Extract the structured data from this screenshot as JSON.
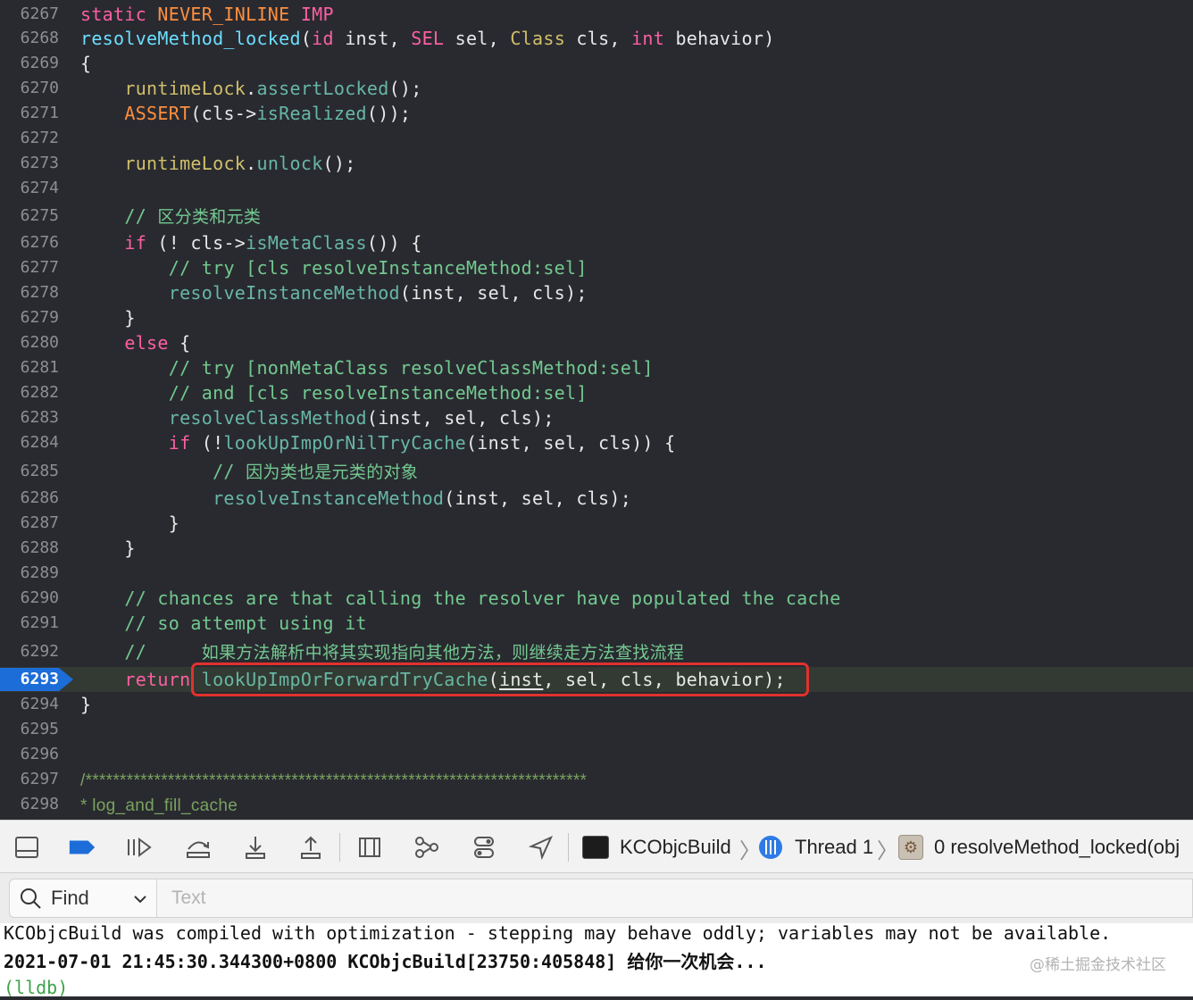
{
  "editor": {
    "lines": [
      {
        "n": "6267",
        "tokens": [
          {
            "t": "static",
            "c": "kw"
          },
          {
            "t": " "
          },
          {
            "t": "NEVER_INLINE",
            "c": "macro"
          },
          {
            "t": " "
          },
          {
            "t": "IMP",
            "c": "kw"
          }
        ]
      },
      {
        "n": "6268",
        "tokens": [
          {
            "t": "resolveMethod_locked",
            "c": "decl"
          },
          {
            "t": "("
          },
          {
            "t": "id",
            "c": "kw"
          },
          {
            "t": " inst, "
          },
          {
            "t": "SEL",
            "c": "kw"
          },
          {
            "t": " sel, "
          },
          {
            "t": "Class",
            "c": "type"
          },
          {
            "t": " cls, "
          },
          {
            "t": "int",
            "c": "kw"
          },
          {
            "t": " behavior)"
          }
        ]
      },
      {
        "n": "6269",
        "tokens": [
          {
            "t": "{"
          }
        ]
      },
      {
        "n": "6270",
        "tokens": [
          {
            "t": "    "
          },
          {
            "t": "runtimeLock",
            "c": "type"
          },
          {
            "t": "."
          },
          {
            "t": "assertLocked",
            "c": "call"
          },
          {
            "t": "();"
          }
        ]
      },
      {
        "n": "6271",
        "tokens": [
          {
            "t": "    "
          },
          {
            "t": "ASSERT",
            "c": "macro"
          },
          {
            "t": "(cls->"
          },
          {
            "t": "isRealized",
            "c": "call"
          },
          {
            "t": "());"
          }
        ]
      },
      {
        "n": "6272",
        "tokens": []
      },
      {
        "n": "6273",
        "tokens": [
          {
            "t": "    "
          },
          {
            "t": "runtimeLock",
            "c": "type"
          },
          {
            "t": "."
          },
          {
            "t": "unlock",
            "c": "call"
          },
          {
            "t": "();"
          }
        ]
      },
      {
        "n": "6274",
        "tokens": []
      },
      {
        "n": "6275",
        "tokens": [
          {
            "t": "    "
          },
          {
            "t": "// ",
            "c": "cm"
          },
          {
            "t": "区分类和元类",
            "c": "cm cjk"
          }
        ]
      },
      {
        "n": "6276",
        "tokens": [
          {
            "t": "    "
          },
          {
            "t": "if",
            "c": "kw"
          },
          {
            "t": " (! cls->"
          },
          {
            "t": "isMetaClass",
            "c": "call"
          },
          {
            "t": "()) {"
          }
        ]
      },
      {
        "n": "6277",
        "tokens": [
          {
            "t": "        "
          },
          {
            "t": "// try [cls resolveInstanceMethod:sel]",
            "c": "cm"
          }
        ]
      },
      {
        "n": "6278",
        "tokens": [
          {
            "t": "        "
          },
          {
            "t": "resolveInstanceMethod",
            "c": "call"
          },
          {
            "t": "(inst, sel, cls);"
          }
        ]
      },
      {
        "n": "6279",
        "tokens": [
          {
            "t": "    }"
          }
        ]
      },
      {
        "n": "6280",
        "tokens": [
          {
            "t": "    "
          },
          {
            "t": "else",
            "c": "kw"
          },
          {
            "t": " {"
          }
        ]
      },
      {
        "n": "6281",
        "tokens": [
          {
            "t": "        "
          },
          {
            "t": "// try [nonMetaClass resolveClassMethod:sel]",
            "c": "cm"
          }
        ]
      },
      {
        "n": "6282",
        "tokens": [
          {
            "t": "        "
          },
          {
            "t": "// and [cls resolveInstanceMethod:sel]",
            "c": "cm"
          }
        ]
      },
      {
        "n": "6283",
        "tokens": [
          {
            "t": "        "
          },
          {
            "t": "resolveClassMethod",
            "c": "call"
          },
          {
            "t": "(inst, sel, cls);"
          }
        ]
      },
      {
        "n": "6284",
        "tokens": [
          {
            "t": "        "
          },
          {
            "t": "if",
            "c": "kw"
          },
          {
            "t": " (!"
          },
          {
            "t": "lookUpImpOrNilTryCache",
            "c": "call"
          },
          {
            "t": "(inst, sel, cls)) {"
          }
        ]
      },
      {
        "n": "6285",
        "tokens": [
          {
            "t": "            "
          },
          {
            "t": "// ",
            "c": "cm"
          },
          {
            "t": "因为类也是元类的对象",
            "c": "cm cjk"
          }
        ]
      },
      {
        "n": "6286",
        "tokens": [
          {
            "t": "            "
          },
          {
            "t": "resolveInstanceMethod",
            "c": "call"
          },
          {
            "t": "(inst, sel, cls);"
          }
        ]
      },
      {
        "n": "6287",
        "tokens": [
          {
            "t": "        }"
          }
        ]
      },
      {
        "n": "6288",
        "tokens": [
          {
            "t": "    }"
          }
        ]
      },
      {
        "n": "6289",
        "tokens": []
      },
      {
        "n": "6290",
        "tokens": [
          {
            "t": "    "
          },
          {
            "t": "// chances are that calling the resolver have populated the cache",
            "c": "cm"
          }
        ]
      },
      {
        "n": "6291",
        "tokens": [
          {
            "t": "    "
          },
          {
            "t": "// so attempt using it",
            "c": "cm"
          }
        ]
      },
      {
        "n": "6292",
        "tokens": [
          {
            "t": "    "
          },
          {
            "t": "//     ",
            "c": "cm"
          },
          {
            "t": "如果方法解析中将其实现指向其他方法，则继续走方法查找流程",
            "c": "cm cjk"
          }
        ]
      },
      {
        "n": "6293",
        "current": true,
        "tokens": [
          {
            "t": "    "
          },
          {
            "t": "return",
            "c": "kw"
          },
          {
            "t": " "
          },
          {
            "t": "lookUpImpOrForwardTryCache",
            "c": "call"
          },
          {
            "t": "("
          },
          {
            "t": "inst",
            "c": "under"
          },
          {
            "t": ", sel, cls, behavior);"
          }
        ]
      },
      {
        "n": "6294",
        "tokens": [
          {
            "t": "}"
          }
        ]
      },
      {
        "n": "6295",
        "tokens": []
      },
      {
        "n": "6296",
        "tokens": []
      },
      {
        "n": "6297",
        "tokens": [
          {
            "t": "/**",
            "c": "doc"
          },
          {
            "t": "***********************************************************************",
            "c": "doc"
          }
        ]
      },
      {
        "n": "6298",
        "tokens": [
          {
            "t": "* log_and_fill_cache",
            "c": "doc"
          }
        ]
      }
    ]
  },
  "debug_bar": {
    "buttons": [
      {
        "name": "hide-debug-area-icon"
      },
      {
        "name": "breakpoints-toggle-icon",
        "active": true
      },
      {
        "name": "continue-icon"
      },
      {
        "name": "step-over-icon"
      },
      {
        "name": "step-into-icon"
      },
      {
        "name": "step-out-icon"
      },
      {
        "name": "view-hierarchy-icon"
      },
      {
        "name": "memory-graph-icon"
      },
      {
        "name": "environment-overrides-icon"
      },
      {
        "name": "simulate-location-icon"
      }
    ],
    "breadcrumb": {
      "target": "KCObjcBuild",
      "thread": "Thread 1",
      "frame": "0 resolveMethod_locked(obj"
    }
  },
  "find_bar": {
    "mode": "Find",
    "placeholder": "Text"
  },
  "console": {
    "lines": [
      "KCObjcBuild was compiled with optimization - stepping may behave oddly; variables may not be available.",
      "2021-07-01 21:45:30.344300+0800 KCObjcBuild[23750:405848] 给你一次机会...",
      "(lldb)"
    ],
    "watermark": "@稀土掘金技术社区"
  },
  "colors": {
    "editor_bg": "#292a30",
    "keyword": "#fc5fa3",
    "comment": "#73c990",
    "current_line_badge": "#1d6dd8",
    "highlight_box": "#e0322e"
  }
}
